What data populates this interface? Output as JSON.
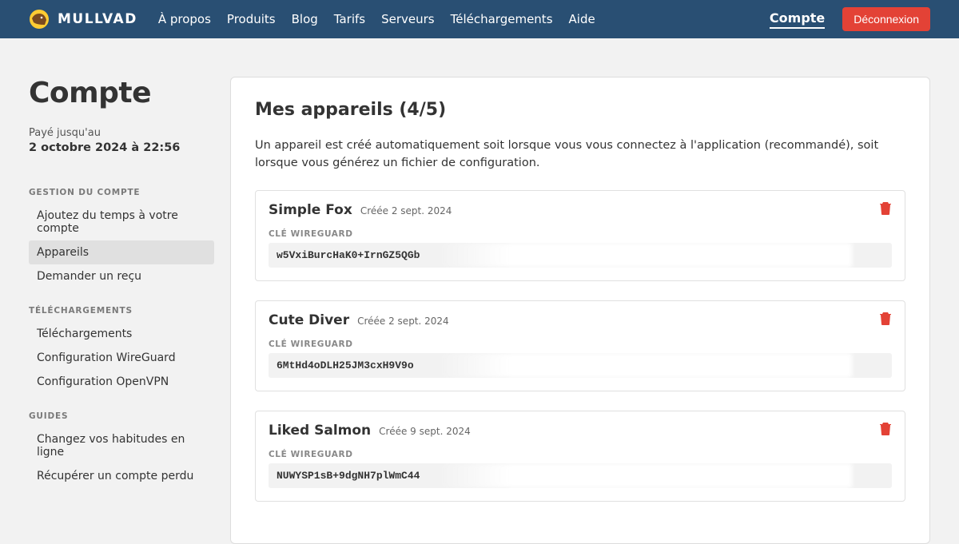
{
  "brand": "MULLVAD",
  "nav": {
    "about": "À propos",
    "products": "Produits",
    "blog": "Blog",
    "pricing": "Tarifs",
    "servers": "Serveurs",
    "downloads": "Téléchargements",
    "help": "Aide"
  },
  "account_link": "Compte",
  "logout": "Déconnexion",
  "sidebar": {
    "title": "Compte",
    "paid_label": "Payé jusqu'au",
    "paid_value": "2 octobre 2024 à 22:56",
    "sections": {
      "manage_title": "GESTION DU COMPTE",
      "add_time": "Ajoutez du temps à votre compte",
      "devices": "Appareils",
      "receipt": "Demander un reçu",
      "downloads_title": "TÉLÉCHARGEMENTS",
      "downloads": "Téléchargements",
      "wireguard": "Configuration WireGuard",
      "openvpn": "Configuration OpenVPN",
      "guides_title": "GUIDES",
      "habits": "Changez vos habitudes en ligne",
      "recover": "Récupérer un compte perdu"
    }
  },
  "panel": {
    "title": "Mes appareils (4/5)",
    "description": "Un appareil est créé automatiquement soit lorsque vous vous connectez à l'application (recommandé), soit lorsque vous générez un fichier de configuration.",
    "key_label": "CLÉ WIREGUARD"
  },
  "devices": [
    {
      "name": "Simple Fox",
      "created": "Créée 2 sept. 2024",
      "key": "w5VxiBurcHaK0+IrnGZ5QGb"
    },
    {
      "name": "Cute Diver",
      "created": "Créée 2 sept. 2024",
      "key": "6MtHd4oDLH25JM3cxH9V9o"
    },
    {
      "name": "Liked Salmon",
      "created": "Créée 9 sept. 2024",
      "key": "NUWYSP1sB+9dgNH7plWmC44"
    }
  ]
}
